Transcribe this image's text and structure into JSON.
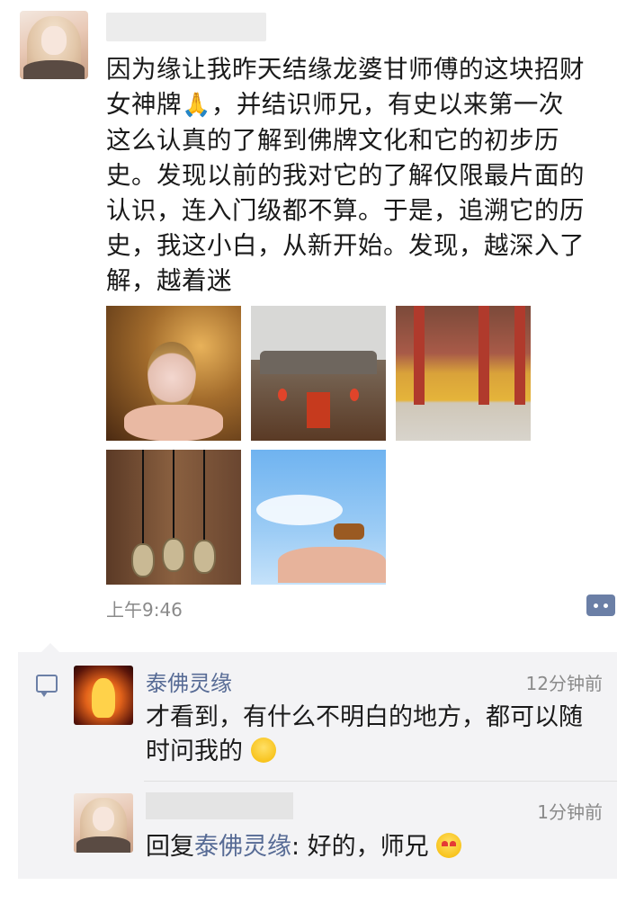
{
  "post": {
    "text_line1": "因为缘让我昨天结缘龙婆甘师傅的这块招财",
    "text_line2a": "女神牌",
    "pray_emoji": "🙏",
    "text_line2b": "，并结识师兄，有史以来第一次",
    "text_line3": "这么认真的了解到佛牌文化和它的初步历",
    "text_line4": "史。发现以前的我对它的了解仅限最片面的",
    "text_line5": "认识，连入门级都不算。于是，追溯它的历",
    "text_line6": "史，我这小白，从新开始。发现，越深入了",
    "text_line7": "解，越着迷",
    "time": "上午9:46"
  },
  "comments": [
    {
      "name": "泰佛灵缘",
      "time": "12分钟前",
      "text_line1": "才看到，有什么不明白的地方，都可以随",
      "text_line2": "时问我的"
    }
  ],
  "reply": {
    "time": "1分钟前",
    "prefix": "回复",
    "target": "泰佛灵缘",
    "text": ": 好的，师兄"
  },
  "icons": [
    "avatar",
    "more-actions-icon",
    "comment-icon",
    "grin-emoji",
    "love-emoji"
  ],
  "colors": {
    "link": "#576b95",
    "comment_bg": "#f3f3f5",
    "time": "#8a8a8a"
  }
}
